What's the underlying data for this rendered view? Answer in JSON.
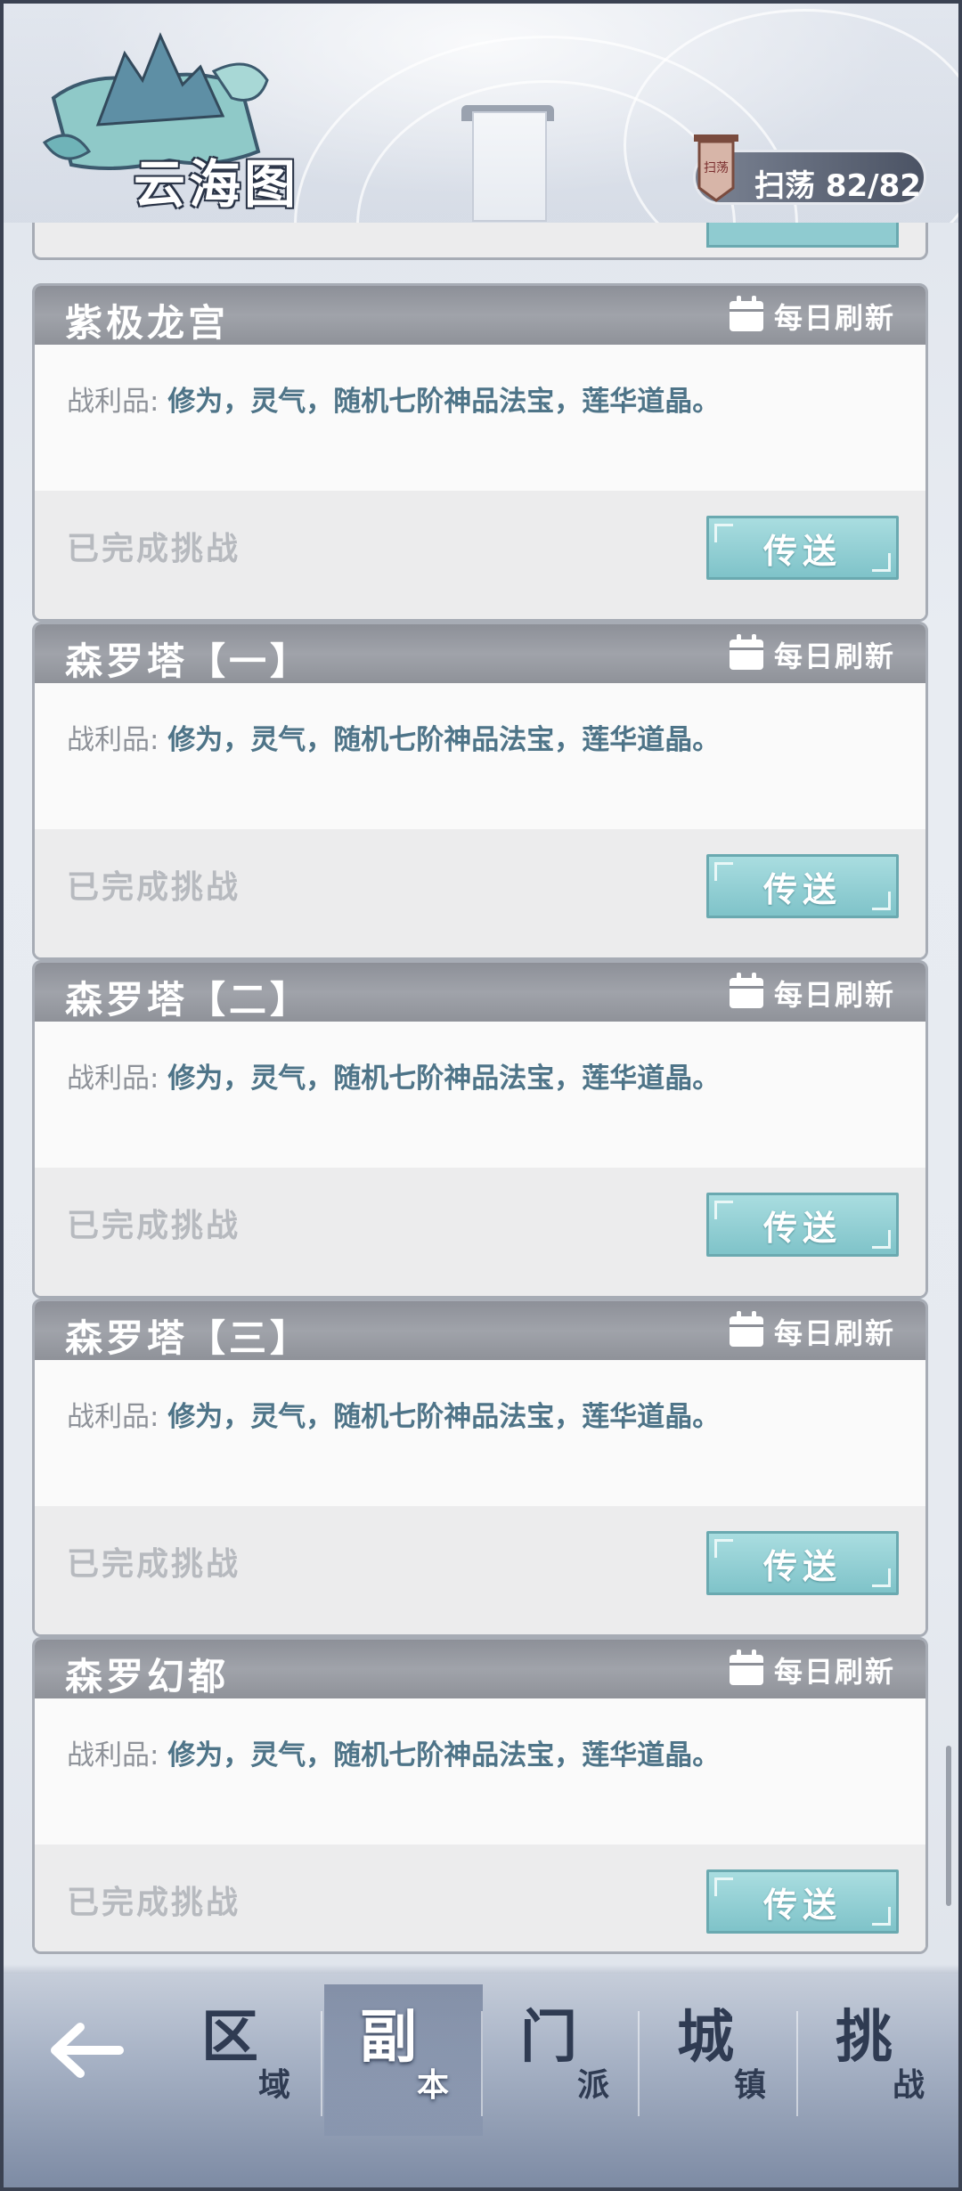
{
  "header": {
    "title": "云海图",
    "sweep_label": "扫荡 82/82",
    "sweep_icon_text": "扫荡"
  },
  "common": {
    "reward_label": "战利品:",
    "refresh_label": "每日刷新",
    "teleport_label": "传送"
  },
  "dungeons": [
    {
      "name": "紫极龙宫",
      "reward": "修为，灵气，随机七阶神品法宝，莲华道晶。",
      "status": "已完成挑战"
    },
    {
      "name": "森罗塔【一】",
      "reward": "修为，灵气，随机七阶神品法宝，莲华道晶。",
      "status": "已完成挑战"
    },
    {
      "name": "森罗塔【二】",
      "reward": "修为，灵气，随机七阶神品法宝，莲华道晶。",
      "status": "已完成挑战"
    },
    {
      "name": "森罗塔【三】",
      "reward": "修为，灵气，随机七阶神品法宝，莲华道晶。",
      "status": "已完成挑战"
    },
    {
      "name": "森罗幻都",
      "reward": "修为，灵气，随机七阶神品法宝，莲华道晶。",
      "status": "已完成挑战"
    }
  ],
  "nav": {
    "back_icon": "back-arrow-icon",
    "tabs": [
      {
        "big": "区",
        "small": "域",
        "active": false
      },
      {
        "big": "副",
        "small": "本",
        "active": true
      },
      {
        "big": "门",
        "small": "派",
        "active": false
      },
      {
        "big": "城",
        "small": "镇",
        "active": false
      },
      {
        "big": "挑",
        "small": "战",
        "active": false
      }
    ]
  }
}
